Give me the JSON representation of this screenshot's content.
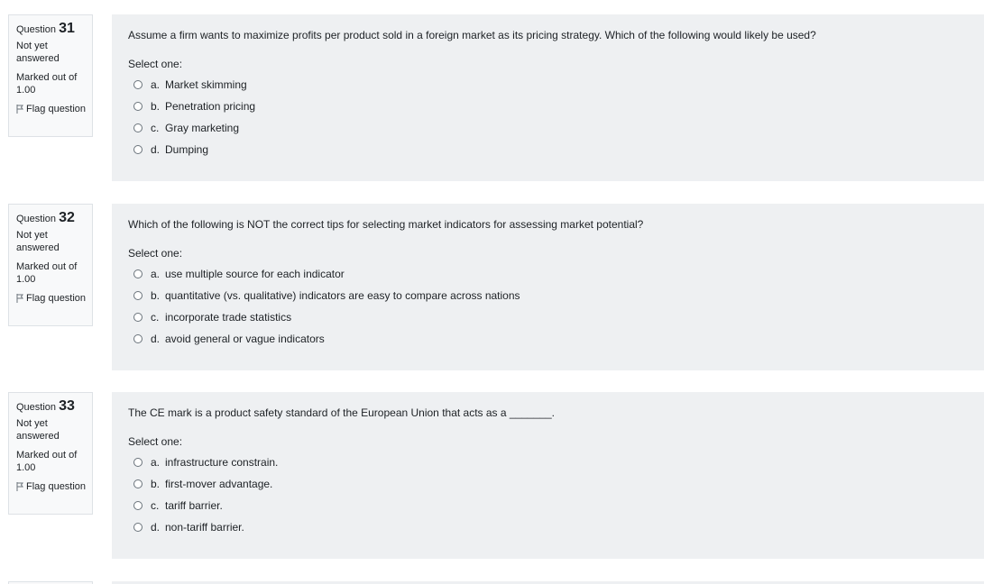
{
  "questions": [
    {
      "label": "Question",
      "number": "31",
      "state": "Not yet answered",
      "grade": "Marked out of 1.00",
      "flag": "Flag question",
      "text": "Assume a firm wants to maximize profits per product sold in a foreign market as its pricing strategy. Which of the following would likely be used?",
      "prompt": "Select one:",
      "options": [
        {
          "letter": "a.",
          "text": "Market skimming"
        },
        {
          "letter": "b.",
          "text": "Penetration pricing"
        },
        {
          "letter": "c.",
          "text": "Gray marketing"
        },
        {
          "letter": "d.",
          "text": "Dumping"
        }
      ]
    },
    {
      "label": "Question",
      "number": "32",
      "state": "Not yet answered",
      "grade": "Marked out of 1.00",
      "flag": "Flag question",
      "text": "Which of the following is NOT the correct tips for selecting market indicators for assessing market potential?",
      "prompt": "Select one:",
      "options": [
        {
          "letter": "a.",
          "text": "use multiple source for each indicator"
        },
        {
          "letter": "b.",
          "text": "quantitative (vs. qualitative) indicators are easy to compare across nations"
        },
        {
          "letter": "c.",
          "text": "incorporate trade statistics"
        },
        {
          "letter": "d.",
          "text": "avoid general or vague indicators"
        }
      ]
    },
    {
      "label": "Question",
      "number": "33",
      "state": "Not yet answered",
      "grade": "Marked out of 1.00",
      "flag": "Flag question",
      "text": "The CE mark is a product safety standard of the European Union that acts as a _______.",
      "prompt": "Select one:",
      "options": [
        {
          "letter": "a.",
          "text": "infrastructure constrain."
        },
        {
          "letter": "b.",
          "text": "first-mover advantage."
        },
        {
          "letter": "c.",
          "text": "tariff barrier."
        },
        {
          "letter": "d.",
          "text": "non-tariff barrier."
        }
      ]
    }
  ]
}
